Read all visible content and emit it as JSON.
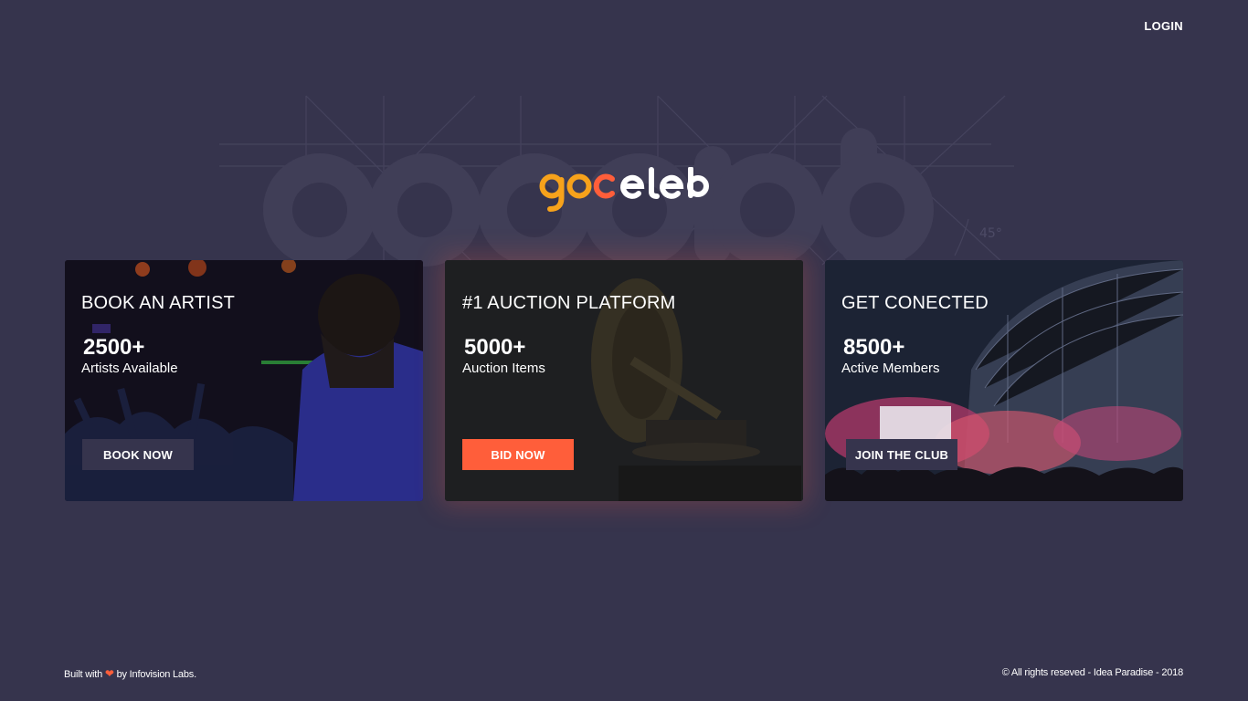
{
  "header": {
    "login_label": "LOGIN"
  },
  "brand": {
    "logo_text": "goceleb",
    "colors": {
      "g": "#f7a21b",
      "o": "#f7a21b",
      "c": "#ff5e3a",
      "rest": "#ffffff"
    },
    "watermark_angle_label": "45°"
  },
  "cards": [
    {
      "title": "BOOK AN ARTIST",
      "count": "2500+",
      "subtitle": "Artists Available",
      "button_label": "BOOK NOW"
    },
    {
      "title": "#1 AUCTION PLATFORM",
      "count": "5000+",
      "subtitle": "Auction Items",
      "button_label": "BID NOW"
    },
    {
      "title": "GET CONECTED",
      "count": "8500+",
      "subtitle": "Active Members",
      "button_label": "JOIN THE CLUB"
    }
  ],
  "footer": {
    "built_with": "Built with",
    "heart_icon": "heart-icon",
    "by_text": "by Infovision Labs.",
    "copyright": "© All rights reseved - Idea Paradise - 2018"
  },
  "theme": {
    "background": "#36344d",
    "accent": "#ff5e3a",
    "logo_orange": "#f7a21b"
  }
}
